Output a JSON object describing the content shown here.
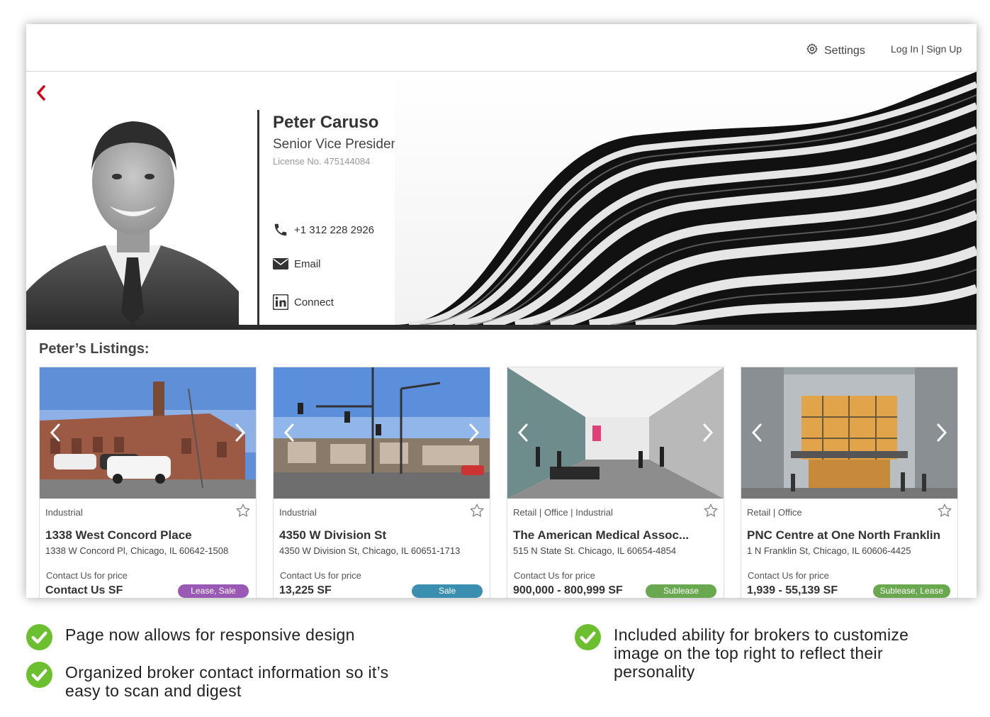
{
  "nav": {
    "settings_label": "Settings",
    "auth_label": "Log In | Sign Up"
  },
  "broker": {
    "name": "Peter Caruso",
    "title": "Senior Vice President",
    "license": "License No. 475144084",
    "phone": "+1 312 228 2926",
    "email_label": "Email",
    "linkedin_label": "Connect"
  },
  "listings_title": "Peter’s Listings:",
  "listings": [
    {
      "type": "Industrial",
      "name": "1338 West Concord Place",
      "address": "1338 W Concord Pl, Chicago, IL 60642-1508",
      "price_note": "Contact Us for price",
      "size": "Contact Us SF",
      "badge": "Lease, Sale",
      "badge_color": "#9b59b6"
    },
    {
      "type": "Industrial",
      "name": "4350 W Division St",
      "address": "4350 W Division St, Chicago, IL 60651-1713",
      "price_note": "Contact Us for price",
      "size": "13,225 SF",
      "badge": "Sale",
      "badge_color": "#3a8fb0"
    },
    {
      "type": "Retail | Office | Industrial",
      "name": "The American Medical Assoc...",
      "address": "515 N State St. Chicago, IL 60654-4854",
      "price_note": "Contact Us for price",
      "size": "900,000 - 800,999 SF",
      "badge": "Sublease",
      "badge_color": "#6aa84f"
    },
    {
      "type": "Retail | Office",
      "name": "PNC Centre at One North Franklin",
      "address": "1 N Franklin St, Chicago, IL 60606-4425",
      "price_note": "Contact Us for price",
      "size": "1,939 - 55,139 SF",
      "badge": "Sublease, Lease",
      "badge_color": "#6aa84f"
    }
  ],
  "notes": [
    "Page now allows for responsive design",
    "Organized broker contact information so it’s easy to scan and digest",
    "Included ability for brokers to customize image on the top right to reflect their personality"
  ],
  "colors": {
    "accent": "#d9001b",
    "check": "#6cbf2e",
    "hero_bar": "#2b2b2b"
  }
}
